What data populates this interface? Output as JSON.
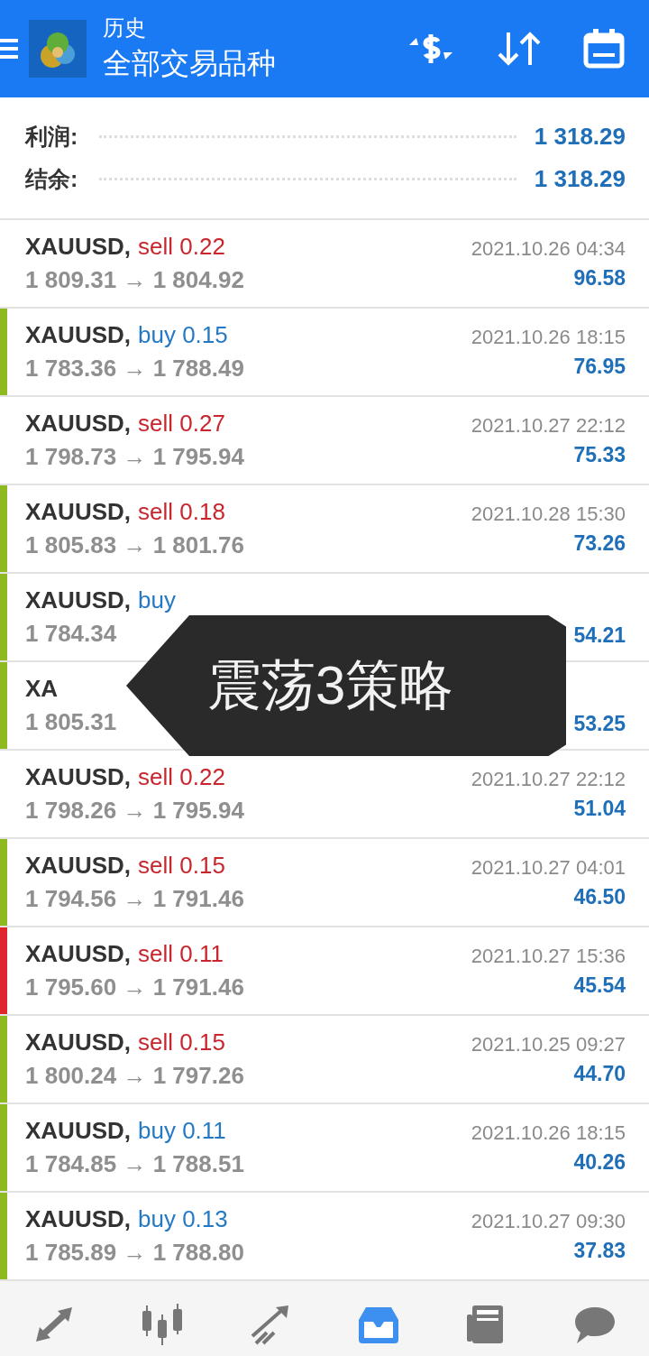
{
  "header": {
    "subtitle": "历史",
    "title": "全部交易品种"
  },
  "summary": [
    {
      "label": "利润:",
      "value": "1 318.29"
    },
    {
      "label": "结余:",
      "value": "1 318.29"
    }
  ],
  "deals": [
    {
      "symbol": "XAUUSD,",
      "kind": "sell",
      "order": "sell 0.22",
      "prices": "1 809.31 → 1 804.92",
      "time": "2021.10.26 04:34",
      "profit": "96.58"
    },
    {
      "symbol": "XAUUSD,",
      "kind": "buy",
      "order": "buy 0.15",
      "prices": "1 783.36 → 1 788.49",
      "time": "2021.10.26 18:15",
      "profit": "76.95",
      "color": "#8dbb1f"
    },
    {
      "symbol": "XAUUSD,",
      "kind": "sell",
      "order": "sell 0.27",
      "prices": "1 798.73 → 1 795.94",
      "time": "2021.10.27 22:12",
      "profit": "75.33"
    },
    {
      "symbol": "XAUUSD,",
      "kind": "sell",
      "order": "sell 0.18",
      "prices": "1 805.83 → 1 801.76",
      "time": "2021.10.28 15:30",
      "profit": "73.26",
      "color": "#8dbb1f"
    },
    {
      "symbol": "XAUUSD,",
      "kind": "buy",
      "order": "buy",
      "prices": "1 784.34",
      "profit": "54.21",
      "color": "#8dbb1f"
    },
    {
      "symbol": "XA",
      "prices": "1 805.31",
      "profit": "53.25",
      "color": "#8dbb1f"
    },
    {
      "symbol": "XAUUSD,",
      "kind": "sell",
      "order": "sell 0.22",
      "prices": "1 798.26 → 1 795.94",
      "time": "2021.10.27 22:12",
      "profit": "51.04"
    },
    {
      "symbol": "XAUUSD,",
      "kind": "sell",
      "order": "sell 0.15",
      "prices": "1 794.56 → 1 791.46",
      "time": "2021.10.27 04:01",
      "profit": "46.50",
      "color": "#8dbb1f"
    },
    {
      "symbol": "XAUUSD,",
      "kind": "sell",
      "order": "sell 0.11",
      "prices": "1 795.60 → 1 791.46",
      "time": "2021.10.27 15:36",
      "profit": "45.54",
      "color": "#e0262d"
    },
    {
      "symbol": "XAUUSD,",
      "kind": "sell",
      "order": "sell 0.15",
      "prices": "1 800.24 → 1 797.26",
      "time": "2021.10.25 09:27",
      "profit": "44.70",
      "color": "#8dbb1f"
    },
    {
      "symbol": "XAUUSD,",
      "kind": "buy",
      "order": "buy 0.11",
      "prices": "1 784.85 → 1 788.51",
      "time": "2021.10.26 18:15",
      "profit": "40.26",
      "color": "#8dbb1f"
    },
    {
      "symbol": "XAUUSD,",
      "kind": "buy",
      "order": "buy 0.13",
      "prices": "1 785.89 → 1 788.80",
      "time": "2021.10.27 09:30",
      "profit": "37.83",
      "color": "#8dbb1f"
    }
  ],
  "callout": {
    "text": "震荡3策略"
  },
  "nav": [
    {
      "kind": "trade",
      "selected": false
    },
    {
      "kind": "chart",
      "selected": false
    },
    {
      "kind": "trend",
      "selected": false
    },
    {
      "kind": "inbox",
      "selected": true
    },
    {
      "kind": "news",
      "selected": false
    },
    {
      "kind": "chat",
      "selected": false
    }
  ]
}
